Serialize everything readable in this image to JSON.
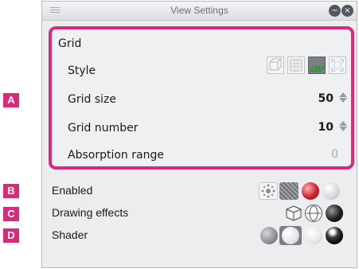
{
  "callouts": [
    "A",
    "B",
    "C",
    "D"
  ],
  "window": {
    "title": "View Settings",
    "minimize_glyph": "−",
    "close_glyph": "×"
  },
  "grid": {
    "heading": "Grid",
    "style_label": "Style",
    "style_icons": [
      "cube-icon",
      "grid-plane-icon",
      "floor-grid-icon",
      "bracket-box-icon"
    ],
    "selected_style_index": 2,
    "grid_size_label": "Grid size",
    "grid_size_value": "50",
    "grid_number_label": "Grid number",
    "grid_number_value": "10",
    "absorption_label": "Absorption range",
    "absorption_value": "0"
  },
  "settings": {
    "enabled_label": "Enabled",
    "enabled_icons": [
      "dots-icon",
      "texture-icon",
      "red-sphere-icon",
      "gray-sphere-icon"
    ],
    "drawing_effects_label": "Drawing effects",
    "drawing_effects_icons": [
      "wire-cube-icon",
      "wire-sphere-icon",
      "black-sphere-icon"
    ],
    "shader_label": "Shader",
    "shader_icons": [
      "textured-sphere-icon",
      "white-sphere-selected-icon",
      "white-sphere-icon",
      "black-shine-sphere-icon"
    ]
  },
  "colors": {
    "accent": "#d92b7a",
    "selected": "#7b7e84",
    "floor_green": "#4cb94c"
  }
}
